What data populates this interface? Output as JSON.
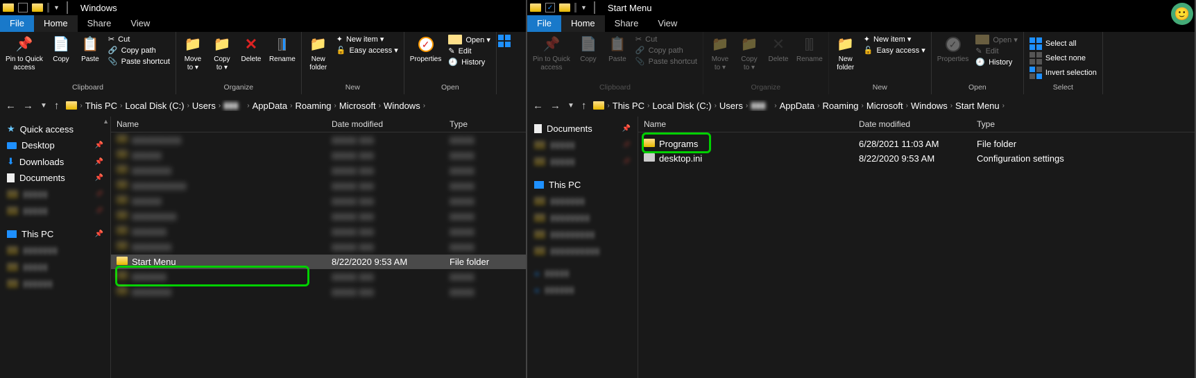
{
  "left": {
    "title": "Windows",
    "tabs": {
      "file": "File",
      "home": "Home",
      "share": "Share",
      "view": "View"
    },
    "ribbon": {
      "pin": "Pin to Quick\naccess",
      "copy": "Copy",
      "paste": "Paste",
      "cut": "Cut",
      "copypath": "Copy path",
      "pasteshort": "Paste shortcut",
      "moveto": "Move\nto ▾",
      "copyto": "Copy\nto ▾",
      "delete": "Delete",
      "rename": "Rename",
      "newfolder": "New\nfolder",
      "newitem": "New item ▾",
      "easyaccess": "Easy access ▾",
      "properties": "Properties",
      "open": "Open ▾",
      "edit": "Edit",
      "history": "History",
      "groups": {
        "clipboard": "Clipboard",
        "organize": "Organize",
        "new": "New",
        "open": "Open"
      }
    },
    "breadcrumb": [
      "This PC",
      "Local Disk (C:)",
      "Users",
      "",
      "AppData",
      "Roaming",
      "Microsoft",
      "Windows"
    ],
    "sidebar": {
      "quick": "Quick access",
      "desktop": "Desktop",
      "downloads": "Downloads",
      "documents": "Documents",
      "thispc": "This PC"
    },
    "columns": {
      "name": "Name",
      "modified": "Date modified",
      "type": "Type"
    },
    "col_widths": {
      "name": 310,
      "modified": 170,
      "type": 80
    },
    "highlighted_row": {
      "name": "Start Menu",
      "modified": "8/22/2020 9:53 AM",
      "type": "File folder"
    }
  },
  "right": {
    "title": "Start Menu",
    "tabs": {
      "file": "File",
      "home": "Home",
      "share": "Share",
      "view": "View"
    },
    "ribbon": {
      "pin": "Pin to Quick\naccess",
      "copy": "Copy",
      "paste": "Paste",
      "cut": "Cut",
      "copypath": "Copy path",
      "pasteshort": "Paste shortcut",
      "moveto": "Move\nto ▾",
      "copyto": "Copy\nto ▾",
      "delete": "Delete",
      "rename": "Rename",
      "newfolder": "New\nfolder",
      "newitem": "New item ▾",
      "easyaccess": "Easy access ▾",
      "properties": "Properties",
      "open": "Open ▾",
      "edit": "Edit",
      "history": "History",
      "selectall": "Select all",
      "selectnone": "Select none",
      "invertsel": "Invert selection",
      "groups": {
        "clipboard": "Clipboard",
        "organize": "Organize",
        "new": "New",
        "open": "Open",
        "select": "Select"
      }
    },
    "breadcrumb": [
      "This PC",
      "Local Disk (C:)",
      "Users",
      "",
      "AppData",
      "Roaming",
      "Microsoft",
      "Windows",
      "Start Menu"
    ],
    "sidebar": {
      "documents": "Documents",
      "thispc": "This PC"
    },
    "columns": {
      "name": "Name",
      "modified": "Date modified",
      "type": "Type"
    },
    "col_widths": {
      "name": 310,
      "modified": 170,
      "type": 160
    },
    "rows": [
      {
        "name": "Programs",
        "modified": "6/28/2021 11:03 AM",
        "type": "File folder",
        "highlight": true
      },
      {
        "name": "desktop.ini",
        "modified": "8/22/2020 9:53 AM",
        "type": "Configuration settings"
      }
    ]
  }
}
